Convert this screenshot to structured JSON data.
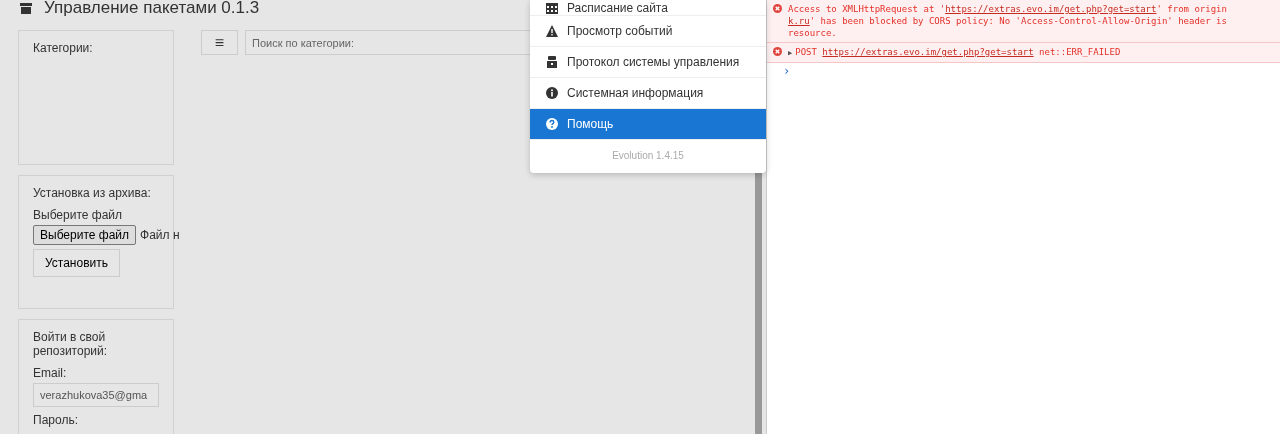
{
  "page": {
    "title": "Управление пакетами 0.1.3",
    "categories_panel": {
      "heading": "Категории:"
    },
    "archive_panel": {
      "heading": "Установка из архива:",
      "file_label": "Выберите файл",
      "file_button": "Выберите файл",
      "file_status": "Файл н",
      "install_button": "Установить"
    },
    "repo_panel": {
      "heading": "Войти в свой репозиторий:",
      "email_label": "Email:",
      "email_value": "verazhukova35@gma",
      "password_label": "Пароль:"
    },
    "toolbar": {
      "menu_button": "≡",
      "search_placeholder": "Поиск по категории:"
    }
  },
  "menu": {
    "items": [
      {
        "kind": "calendar",
        "label": "Расписание сайта",
        "selected": false
      },
      {
        "kind": "warning",
        "label": "Просмотр событий",
        "selected": false
      },
      {
        "kind": "log",
        "label": "Протокол системы управления",
        "selected": false
      },
      {
        "kind": "info",
        "label": "Системная информация",
        "selected": false
      },
      {
        "kind": "help",
        "label": "Помощь",
        "selected": true
      }
    ],
    "footer": "Evolution 1.4.15"
  },
  "console": {
    "messages": [
      {
        "kind": "error",
        "lines": [
          [
            {
              "text": "Access to XMLHttpRequest at '",
              "link": false
            },
            {
              "text": "https://extras.evo.im/get.php?get=start",
              "link": true
            },
            {
              "text": "' from origin",
              "link": false
            }
          ],
          [
            {
              "text": "k.ru",
              "link": true
            },
            {
              "text": "' has been blocked by CORS policy: No 'Access-Control-Allow-Origin' header is",
              "link": false
            }
          ],
          [
            {
              "text": "resource.",
              "link": false
            }
          ]
        ]
      },
      {
        "kind": "error",
        "expander": "▶",
        "lines": [
          [
            {
              "text": "POST ",
              "link": false
            },
            {
              "text": "https://extras.evo.im/get.php?get=start",
              "link": true
            },
            {
              "text": " net::ERR_FAILED",
              "link": false
            }
          ]
        ]
      }
    ],
    "prompt": "›"
  }
}
